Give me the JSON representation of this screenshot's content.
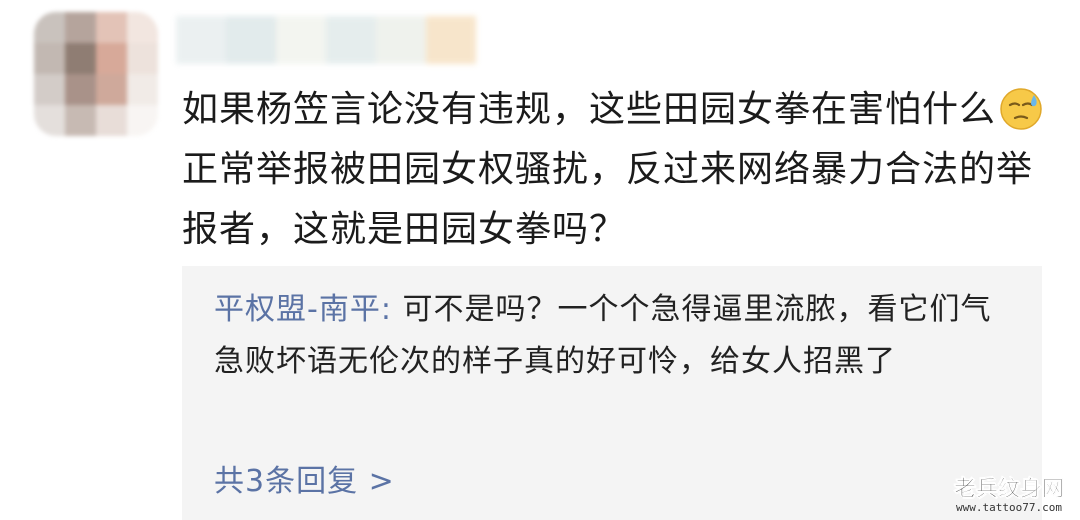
{
  "comment": {
    "text_part1": "如果杨笠言论没有违规，这些田园女拳在害怕什么",
    "emoji": "sweat-face-emoji",
    "text_part2": "正常举报被田园女权骚扰，反过来网络暴力合法的举报者，这就是田园女拳吗？"
  },
  "reply": {
    "author": "平权盟-南平",
    "separator": ": ",
    "text": "可不是吗？一个个急得逼里流脓，看它们气急败坏语无伦次的样子真的好可怜，给女人招黑了"
  },
  "more_replies_label": "共3条回复 >",
  "watermark": {
    "title": "老兵纹身网",
    "url": "www.tattoo77.com"
  },
  "colors": {
    "link_blue": "#5b73a5",
    "reply_bg": "#f4f4f4",
    "text": "#1b1b1b"
  }
}
